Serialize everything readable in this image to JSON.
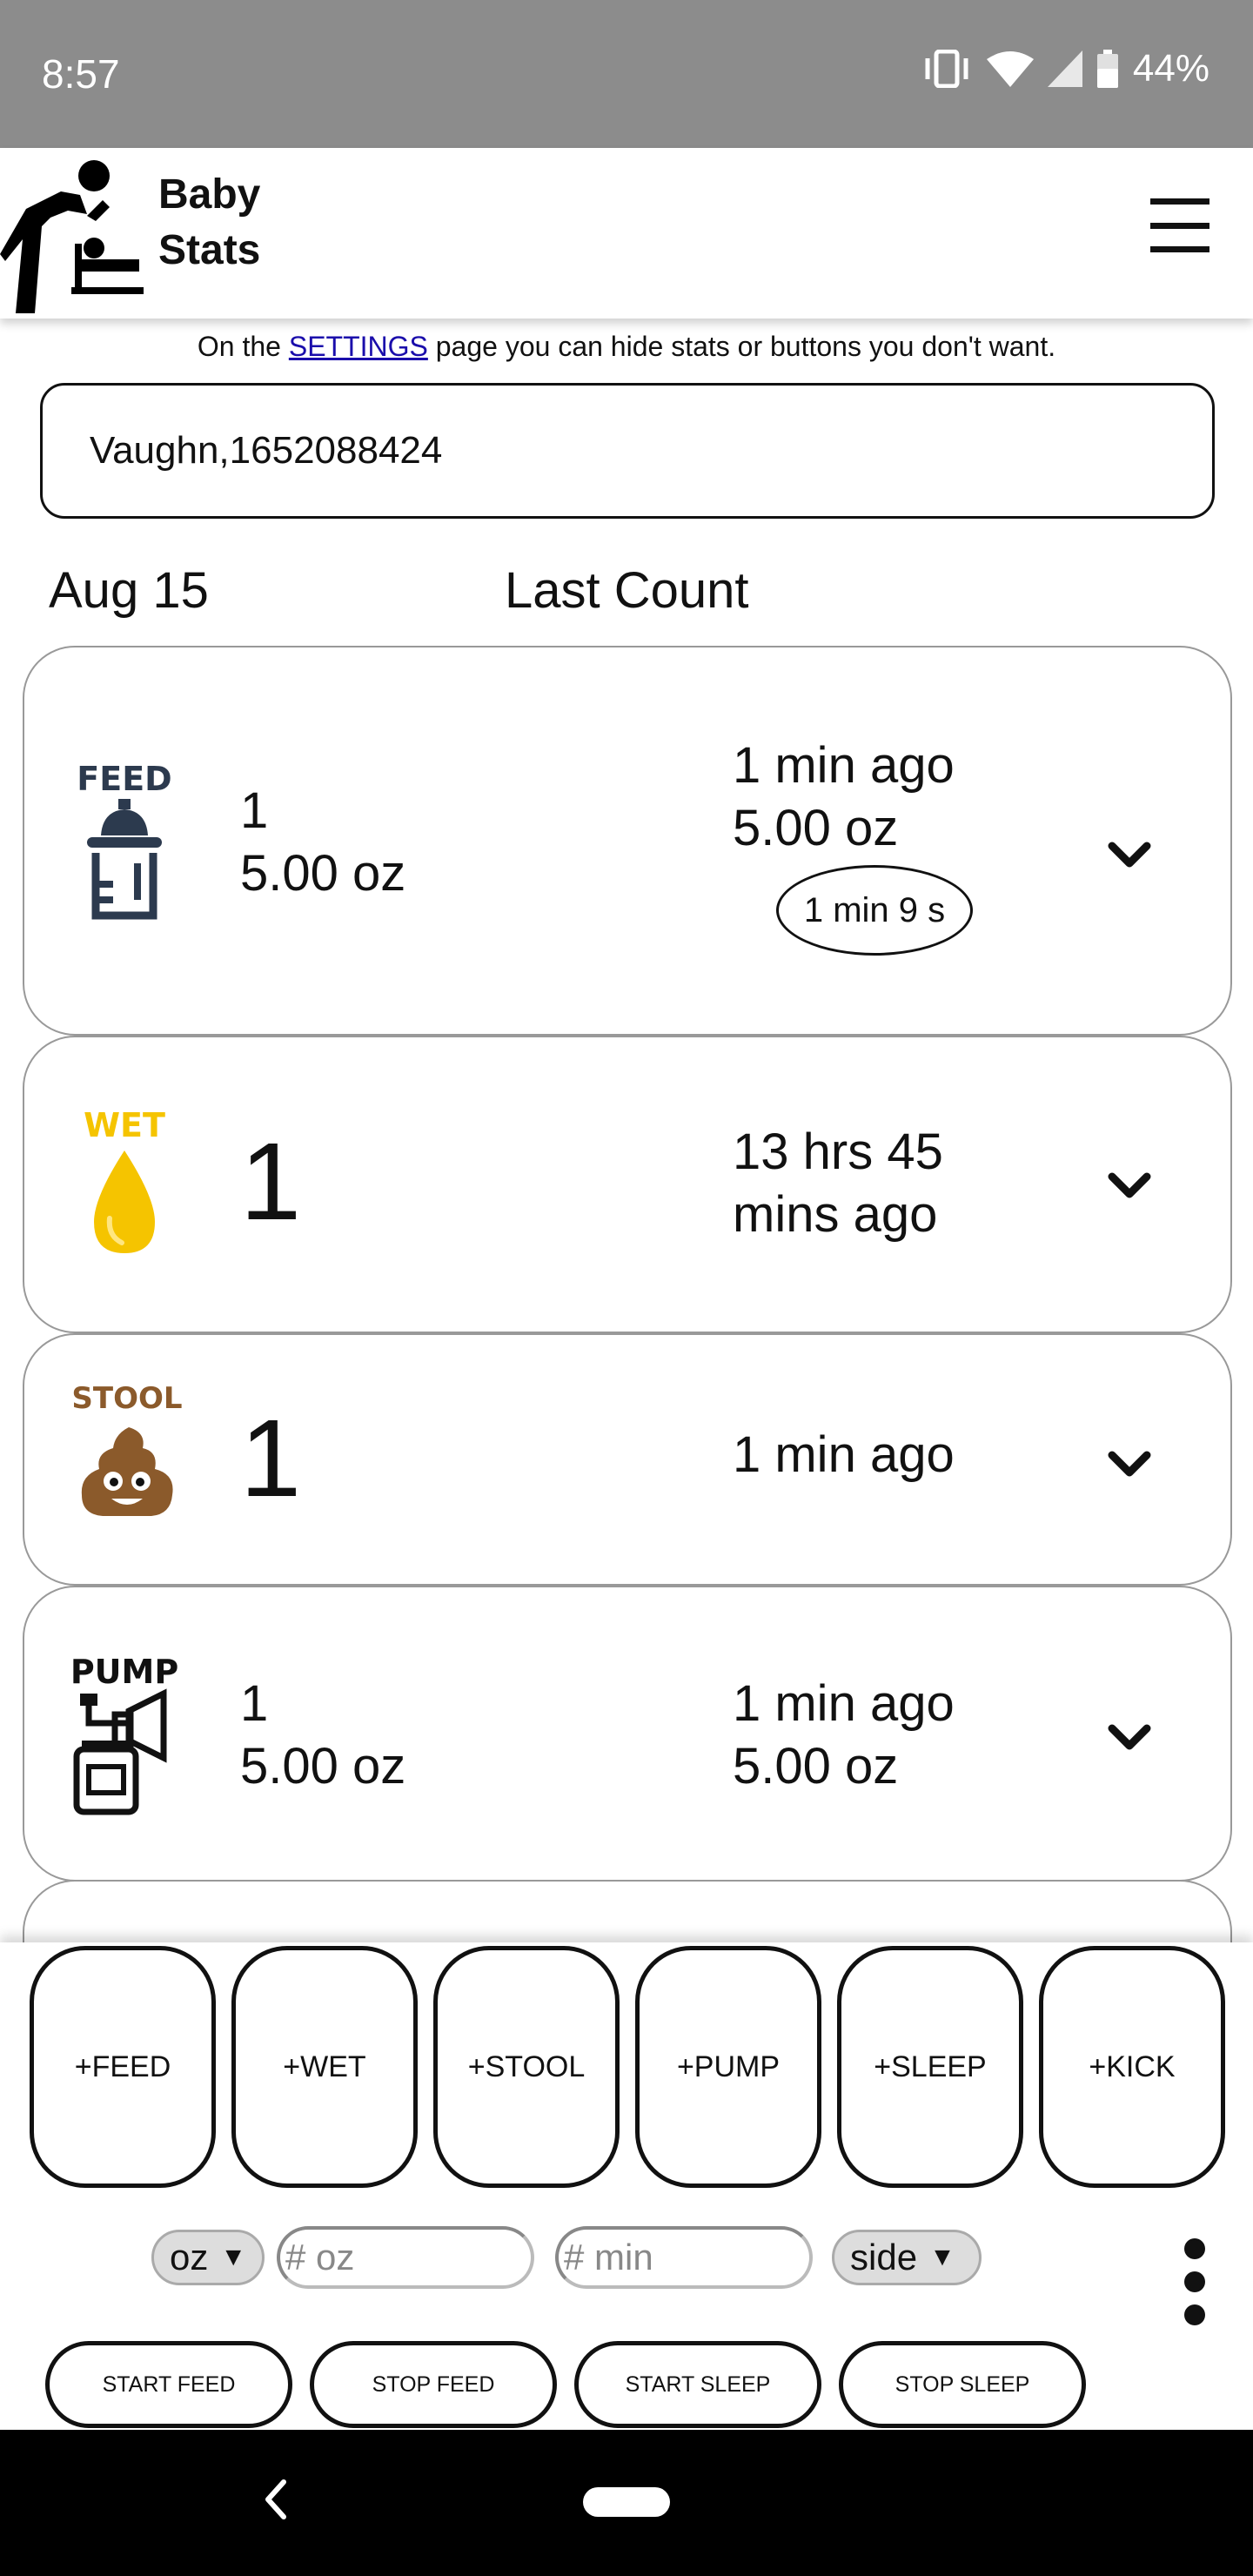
{
  "status_bar": {
    "time": "8:57",
    "battery": "44%",
    "icons": [
      "vibrate-icon",
      "wifi-icon",
      "signal-icon",
      "battery-icon"
    ]
  },
  "header": {
    "brand_line1": "Baby",
    "brand_line2": "Stats",
    "logo": "baby-changing-icon",
    "menu": "hamburger-icon"
  },
  "notice": {
    "before": "On the ",
    "link": "SETTINGS",
    "after": " page you can hide stats or buttons you don't want."
  },
  "name_field": {
    "value": "Vaughn,1652088424"
  },
  "columns": {
    "date": "Aug 15",
    "last": "Last Count"
  },
  "stats": [
    {
      "key": "feed",
      "icon": "feed-bottle-icon",
      "icon_label": "FEED",
      "count": "1",
      "amount": "5.00 oz",
      "last_time": "1 min ago",
      "last_amount": "5.00 oz",
      "timer": "1 min 9 s"
    },
    {
      "key": "wet",
      "icon": "wet-drop-icon",
      "icon_label": "WET",
      "count": "1",
      "last_time_line1": "13 hrs 45",
      "last_time_line2": "mins ago"
    },
    {
      "key": "stool",
      "icon": "stool-poop-icon",
      "icon_label": "STOOL",
      "count": "1",
      "last_time": "1 min ago"
    },
    {
      "key": "pump",
      "icon": "breast-pump-icon",
      "icon_label": "PUMP",
      "count": "1",
      "amount": "5.00 oz",
      "last_time": "1 min ago",
      "last_amount": "5.00 oz"
    }
  ],
  "quick_buttons": [
    "+FEED",
    "+WET",
    "+STOOL",
    "+PUMP",
    "+SLEEP",
    "+KICK"
  ],
  "inputs": {
    "unit_select": "oz",
    "oz_placeholder": "# oz",
    "min_placeholder": "# min",
    "side_select": "side"
  },
  "actions": [
    "START FEED",
    "STOP FEED",
    "START SLEEP",
    "STOP SLEEP"
  ],
  "colors": {
    "status_bar": "#8c8c8c",
    "wet_yellow": "#f5c400",
    "feed_navy": "#2c3a4e",
    "stool_brown": "#8b5a2b",
    "link": "#1a0dab"
  }
}
